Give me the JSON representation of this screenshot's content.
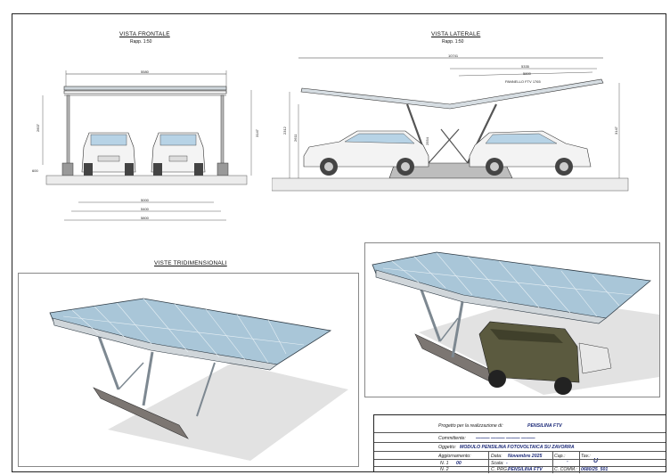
{
  "views": {
    "front": {
      "title": "VISTA FRONTALE",
      "scale": "Rapp. 1:50"
    },
    "side": {
      "title": "VISTA LATERALE",
      "scale": "Rapp. 1:50"
    },
    "threeD": {
      "title": "VISTE TRIDIMENSIONALI"
    }
  },
  "dimensions": {
    "front": {
      "top": "5580",
      "h1": "2607",
      "h2": "3147",
      "base": "600",
      "b1": "5000",
      "b2": "5400",
      "b3": "5800"
    },
    "side": {
      "top": "10741",
      "d1": "5335",
      "d2": "5800",
      "panel": "PANNELLO FTV 1765",
      "h1": "2312",
      "h2": "2611",
      "h3": "3147",
      "mid": "2554"
    }
  },
  "title_block": {
    "project_label": "Progetto per la realizzazione di:",
    "project_value": "PENSILINA FTV",
    "client_label": "Committente:",
    "client_value": "——— ——— ——— ———",
    "object_label": "Oggetto:",
    "object_value": "MODULO PENSILINA FOTOVOLTAICA SU ZAVORRA",
    "update_label": "Aggiornamento:",
    "date_label": "Data:",
    "date_value": "Novembre 2025",
    "cap_label": "Cap.:",
    "cap_value": "-",
    "tav_label": "Tav.:",
    "tav_value": "U",
    "n1_label": "N. 1",
    "n1_value": "00",
    "scale_label": "Scala:",
    "scale_value": "-",
    "n2_label": "N. 2",
    "cprg_label": "C. PRG.:",
    "cprg_value": "PENSILINA FTV",
    "ccomm_label": "C. COMM.:",
    "ccomm_value": "0680/25_501"
  },
  "colors": {
    "panel": "#a9c6d8",
    "steel": "#9aa3aa",
    "ballast": "#8e8a86"
  }
}
